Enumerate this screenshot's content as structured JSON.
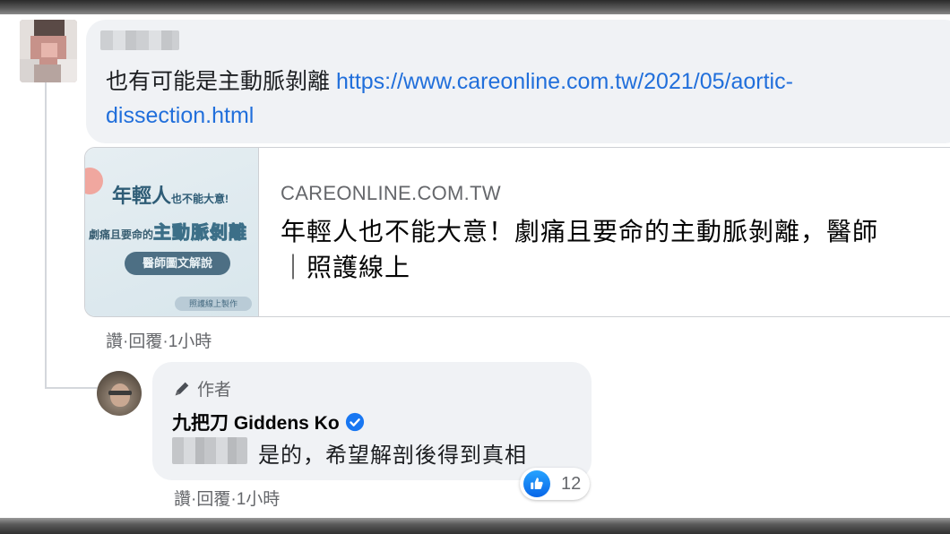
{
  "comment": {
    "text": "也有可能是主動脈剝離",
    "link_line1": "https://www.careonline.com.tw/2021/05/aortic-",
    "link_line2": "dissection.html",
    "link_preview": {
      "thumbnail": {
        "line1_big": "年輕人",
        "line1_small": "也不能大意!",
        "line2_small": "劇痛且要命的",
        "line2_big": "主動脈剝離",
        "pill": "醫師圖文解說",
        "footer": "照護線上製作"
      },
      "domain": "CAREONLINE.COM.TW",
      "title_line1": "年輕人也不能大意！劇痛且要命的主動脈剝離，醫師",
      "title_line2": "｜照護線上"
    },
    "actions": {
      "like": "讚",
      "sep1": " · ",
      "reply": "回覆",
      "sep2": " · ",
      "time": "1小時"
    }
  },
  "reply": {
    "badge": "作者",
    "author": "九把刀 Giddens Ko",
    "text": "是的，希望解剖後得到真相",
    "reaction": {
      "icon": "thumbs-up-icon",
      "count": "12"
    },
    "actions": {
      "like": "讚",
      "sep1": " · ",
      "reply": "回覆",
      "sep2": " · ",
      "time": "1小時"
    }
  },
  "colors": {
    "bubble": "#f0f2f5",
    "link": "#216fdb",
    "meta": "#65676b",
    "verified": "#1877f2",
    "like": "#0866e8"
  }
}
